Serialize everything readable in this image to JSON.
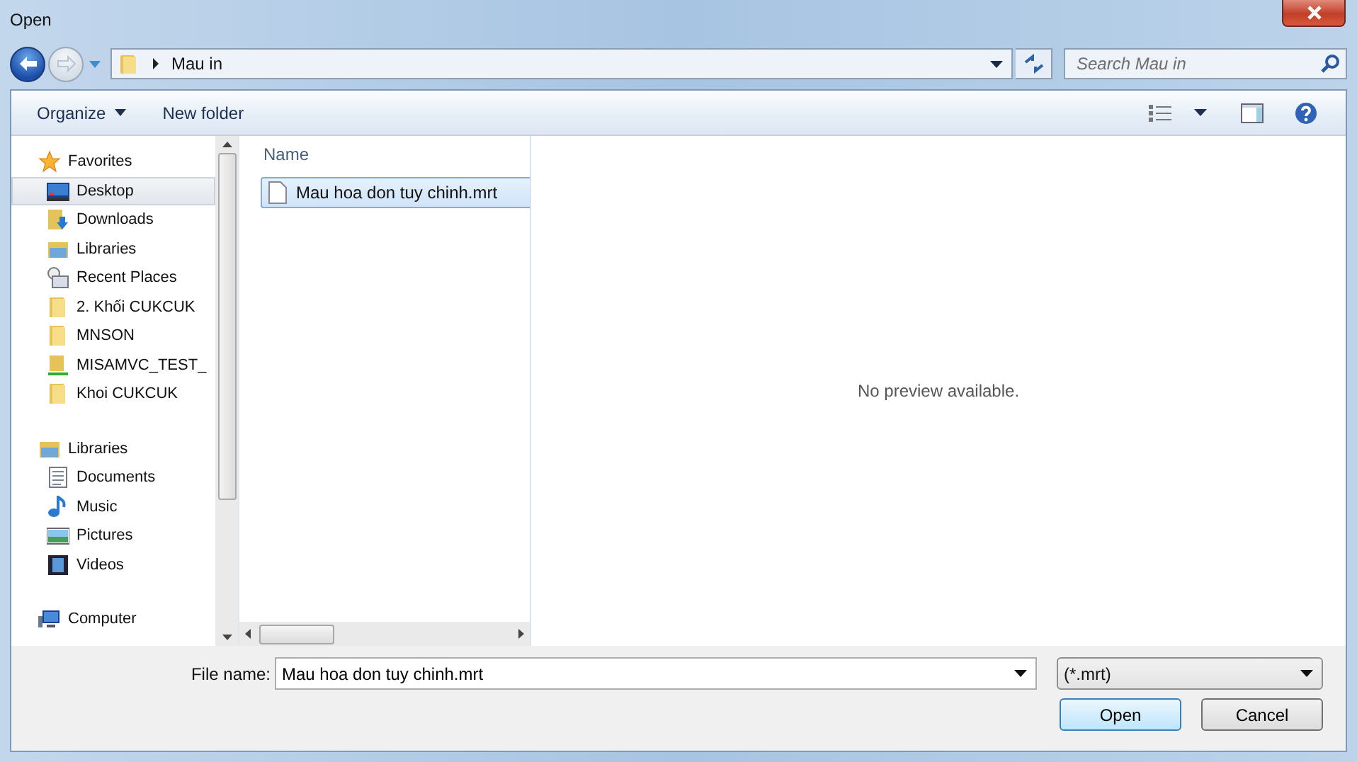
{
  "window": {
    "title": "Open"
  },
  "address": {
    "path": "Mau in"
  },
  "search": {
    "placeholder": "Search Mau in"
  },
  "toolbar": {
    "buttons": [
      "Organize",
      "New folder"
    ]
  },
  "nav": [
    {
      "label": "Favorites",
      "selected": false,
      "children": [
        {
          "label": "Desktop",
          "selected": true
        },
        {
          "label": "Downloads",
          "selected": false
        },
        {
          "label": "Libraries",
          "selected": false
        },
        {
          "label": "Recent Places",
          "selected": false
        },
        {
          "label": "2. Khối CUKCUK",
          "selected": false
        },
        {
          "label": "MNSON",
          "selected": false
        },
        {
          "label": "MISAMVC_TEST_",
          "selected": false
        },
        {
          "label": "Khoi CUKCUK",
          "selected": false
        }
      ]
    },
    {
      "label": "Libraries",
      "selected": false,
      "children": [
        {
          "label": "Documents",
          "selected": false
        },
        {
          "label": "Music",
          "selected": false
        },
        {
          "label": "Pictures",
          "selected": false
        },
        {
          "label": "Videos",
          "selected": false
        }
      ]
    },
    {
      "label": "Computer",
      "selected": false
    }
  ],
  "file_list": {
    "columns": [
      "Name"
    ],
    "files": [
      {
        "name": "Mau hoa don tuy chinh.mrt",
        "selected": true
      }
    ]
  },
  "preview": {
    "text": "No preview available."
  },
  "file_name": {
    "label": "File name:",
    "value": "Mau hoa don tuy chinh.mrt"
  },
  "file_type": {
    "value": "(*.mrt)"
  },
  "buttons": [
    {
      "label": "Open",
      "selected": true
    },
    {
      "label": "Cancel",
      "selected": false
    }
  ]
}
